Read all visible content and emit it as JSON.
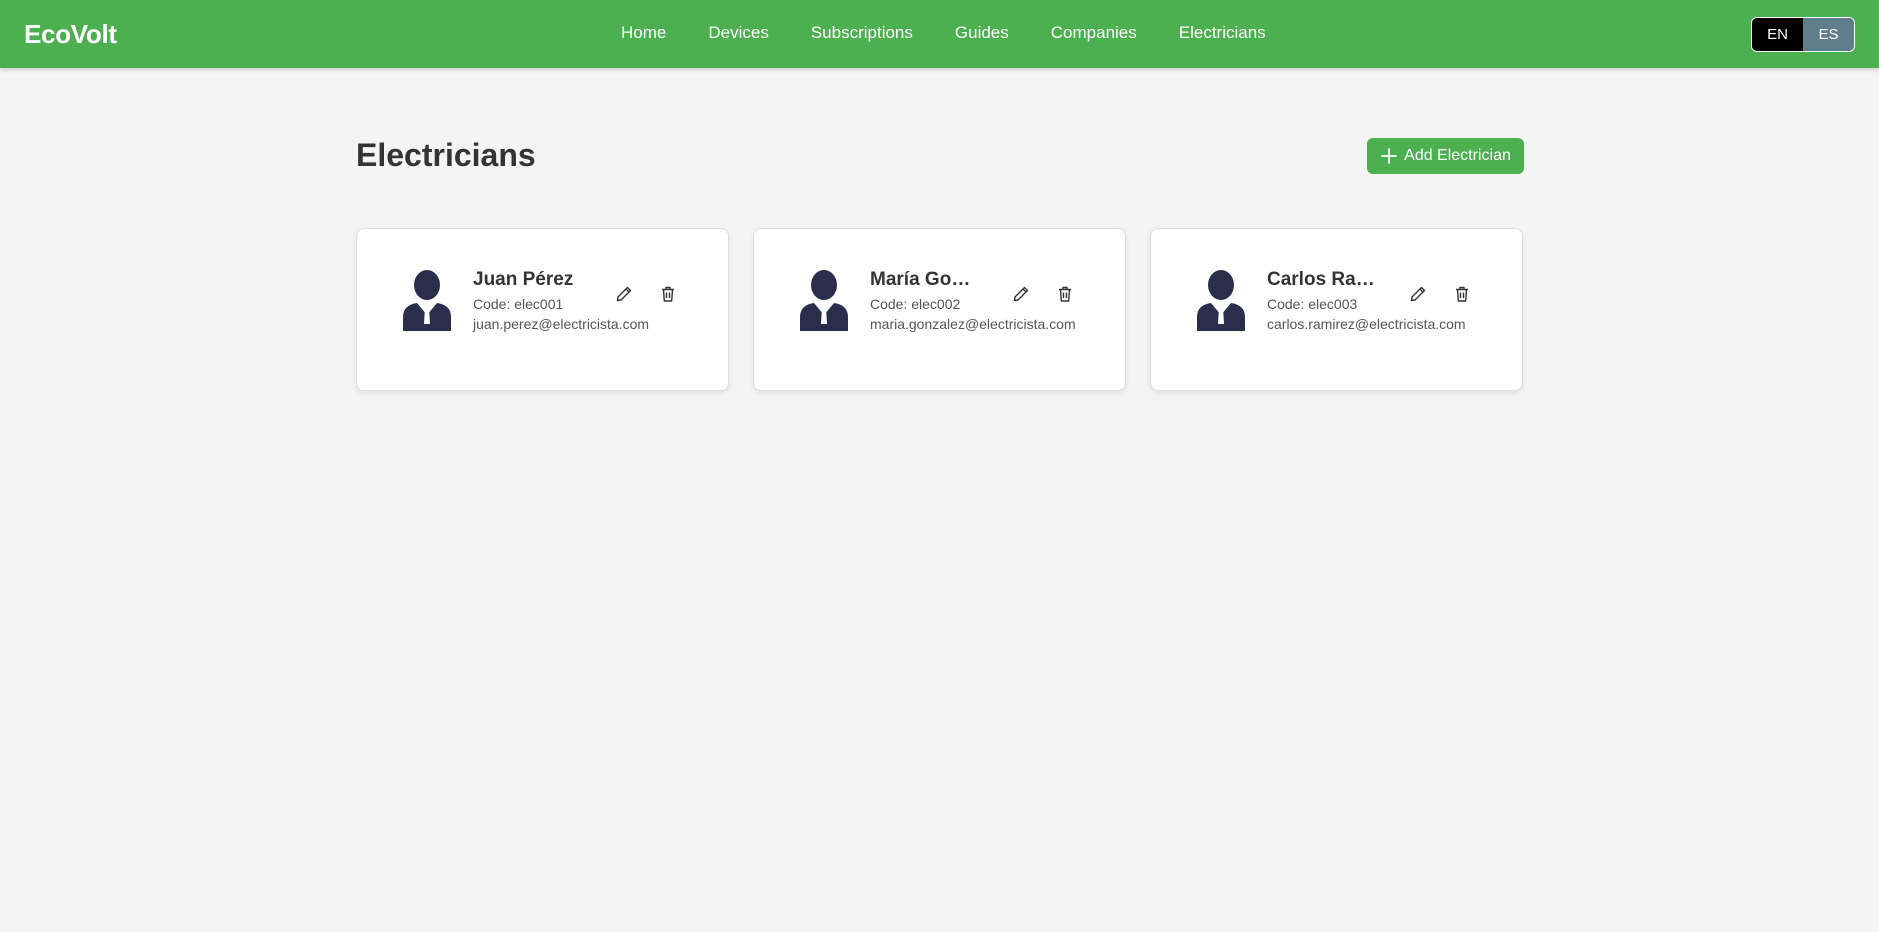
{
  "header": {
    "brand": "EcoVolt",
    "nav": [
      "Home",
      "Devices",
      "Subscriptions",
      "Guides",
      "Companies",
      "Electricians"
    ],
    "lang": {
      "en": "EN",
      "es": "ES",
      "active": "EN"
    }
  },
  "main": {
    "title": "Electricians",
    "add_button": "Add Electrician",
    "electricians": [
      {
        "name": "Juan Pérez",
        "code": "Code: elec001",
        "email": "juan.perez@electricista.com"
      },
      {
        "name": "María González",
        "code": "Code: elec002",
        "email": "maria.gonzalez@electricista.com"
      },
      {
        "name": "Carlos Ramírez",
        "code": "Code: elec003",
        "email": "carlos.ramirez@electricista.com"
      }
    ]
  },
  "icons": {
    "avatar": "person-avatar-icon",
    "edit": "pencil-icon",
    "delete": "trash-icon",
    "add": "plus-icon"
  },
  "colors": {
    "brand_green": "#4caf50",
    "page_bg": "#f4f4f4",
    "lang_active": "#000000",
    "lang_inactive": "#607d8b",
    "avatar": "#2b2e4a"
  }
}
